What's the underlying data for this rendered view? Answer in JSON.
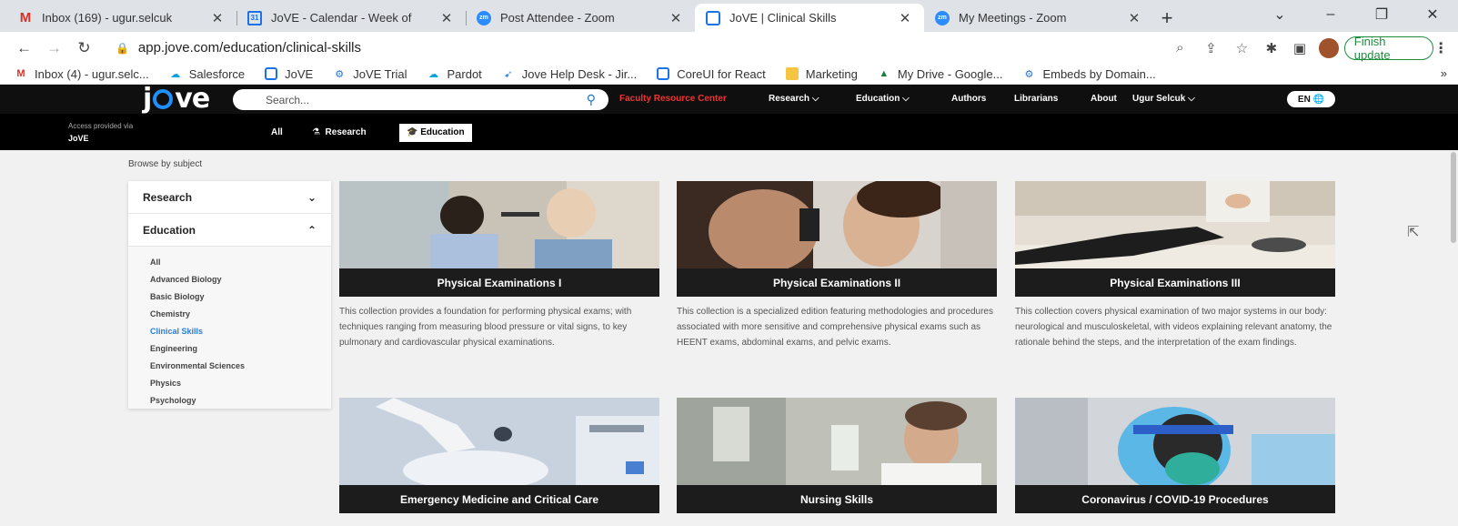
{
  "browser": {
    "tabs": [
      {
        "title": "Inbox (169) - ugur.selcuk",
        "icon": "gmail-icon"
      },
      {
        "title": "JoVE - Calendar - Week of",
        "icon": "calendar-icon"
      },
      {
        "title": "Post Attendee - Zoom",
        "icon": "zoom-icon"
      },
      {
        "title": "JoVE | Clinical Skills",
        "icon": "jove-icon",
        "active": true
      },
      {
        "title": "My Meetings - Zoom",
        "icon": "zoom-icon"
      }
    ],
    "url": "app.jove.com/education/clinical-skills",
    "update_label": "Finish update",
    "bookmarks": [
      {
        "label": "Inbox (4) - ugur.selc...",
        "icon": "gmail-icon"
      },
      {
        "label": "Salesforce",
        "icon": "cloud-icon"
      },
      {
        "label": "JoVE",
        "icon": "jove-icon"
      },
      {
        "label": "JoVE Trial",
        "icon": "gear-icon"
      },
      {
        "label": "Pardot",
        "icon": "cloud-icon"
      },
      {
        "label": "Jove Help Desk - Jir...",
        "icon": "jira-icon"
      },
      {
        "label": "CoreUI for React",
        "icon": "jove-icon"
      },
      {
        "label": "Marketing",
        "icon": "folder-icon"
      },
      {
        "label": "My Drive - Google...",
        "icon": "drive-icon"
      },
      {
        "label": "Embeds by Domain...",
        "icon": "gear-icon"
      }
    ]
  },
  "site": {
    "logo": "jove",
    "search_placeholder": "Search...",
    "nav": {
      "faculty": "Faculty Resource Center",
      "research": "Research",
      "education": "Education",
      "authors": "Authors",
      "librarians": "Librarians",
      "about": "About",
      "user": "Ugur Selcuk",
      "lang": "EN"
    },
    "access_label": "Access provided via",
    "access_org": "JoVE",
    "subtabs": {
      "all": "All",
      "research": "Research",
      "education": "Education"
    }
  },
  "sidebar": {
    "browse_label": "Browse by subject",
    "research": "Research",
    "education": "Education",
    "items": [
      "All",
      "Advanced Biology",
      "Basic Biology",
      "Chemistry",
      "Clinical Skills",
      "Engineering",
      "Environmental Sciences",
      "Physics",
      "Psychology"
    ],
    "active": "Clinical Skills"
  },
  "cards": [
    {
      "title": "Physical Examinations I",
      "desc": "This collection provides a foundation for performing physical exams; with techniques ranging from measuring blood pressure or vital signs, to key pulmonary and cardiovascular physical examinations."
    },
    {
      "title": "Physical Examinations II",
      "desc": "This collection is a specialized edition featuring methodologies and procedures associated with more sensitive and comprehensive physical exams such as HEENT exams, abdominal exams, and pelvic exams."
    },
    {
      "title": "Physical Examinations III",
      "desc": "This collection covers physical examination of two major systems in our body: neurological and musculoskeletal, with videos explaining relevant anatomy, the rationale behind the steps, and the interpretation of the exam findings."
    },
    {
      "title": "Emergency Medicine and Critical Care",
      "desc": ""
    },
    {
      "title": "Nursing Skills",
      "desc": ""
    },
    {
      "title": "Coronavirus / COVID-19 Procedures",
      "desc": ""
    }
  ],
  "colors": {
    "accent": "#2e7bd6",
    "header": "#0f0f0f",
    "faculty_link": "#e33333",
    "update_green": "#1e8e3e"
  }
}
